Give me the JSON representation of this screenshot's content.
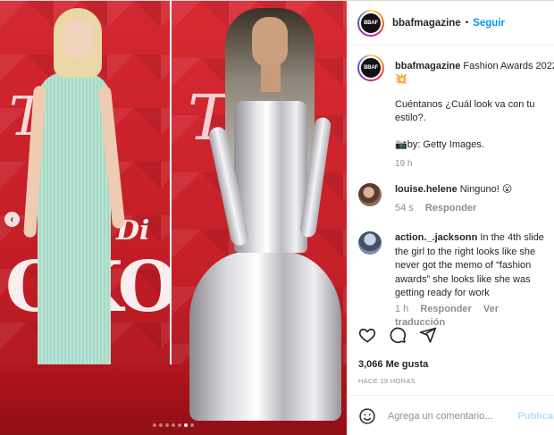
{
  "account": {
    "username": "bbafmagazine",
    "avatar_text": "BBAF",
    "separator": "•",
    "follow_label": "Seguir"
  },
  "caption": {
    "username": "bbafmagazine",
    "line1": "Fashion Awards 2022",
    "emoji": "💥",
    "question": "Cuéntanos ¿Cuál look va con tu estilo?.",
    "credit": "📷by: Getty Images.",
    "time": "19 h"
  },
  "comments": [
    {
      "username": "louise.helene",
      "text": "Ninguno! 😮",
      "time": "54 s",
      "reply_label": "Responder"
    },
    {
      "username": "action._.jacksonn",
      "text": "In the 4th slide the girl to the right looks like she never got the memo of “fashion awards” she looks like she was getting ready for work",
      "time": "1 h",
      "reply_label": "Responder",
      "translate_label": "Ver traducción"
    }
  ],
  "actions": {
    "like_icon": "heart-icon",
    "comment_icon": "comment-icon",
    "share_icon": "share-icon"
  },
  "likes_text": "3,066 Me gusta",
  "posted_ago": "HACE 19 HORAS",
  "comment_box": {
    "placeholder": "Agrega un comentario...",
    "post_label": "Publicar"
  },
  "media": {
    "backdrop_big": "OKO",
    "backdrop_mid": "Di",
    "backdrop_script": "Tl",
    "prev_arrow": "‹",
    "slide_count": 7,
    "active_slide": 6
  },
  "colors": {
    "accent": "#0095f6",
    "backdrop_red": "#c8202a"
  }
}
